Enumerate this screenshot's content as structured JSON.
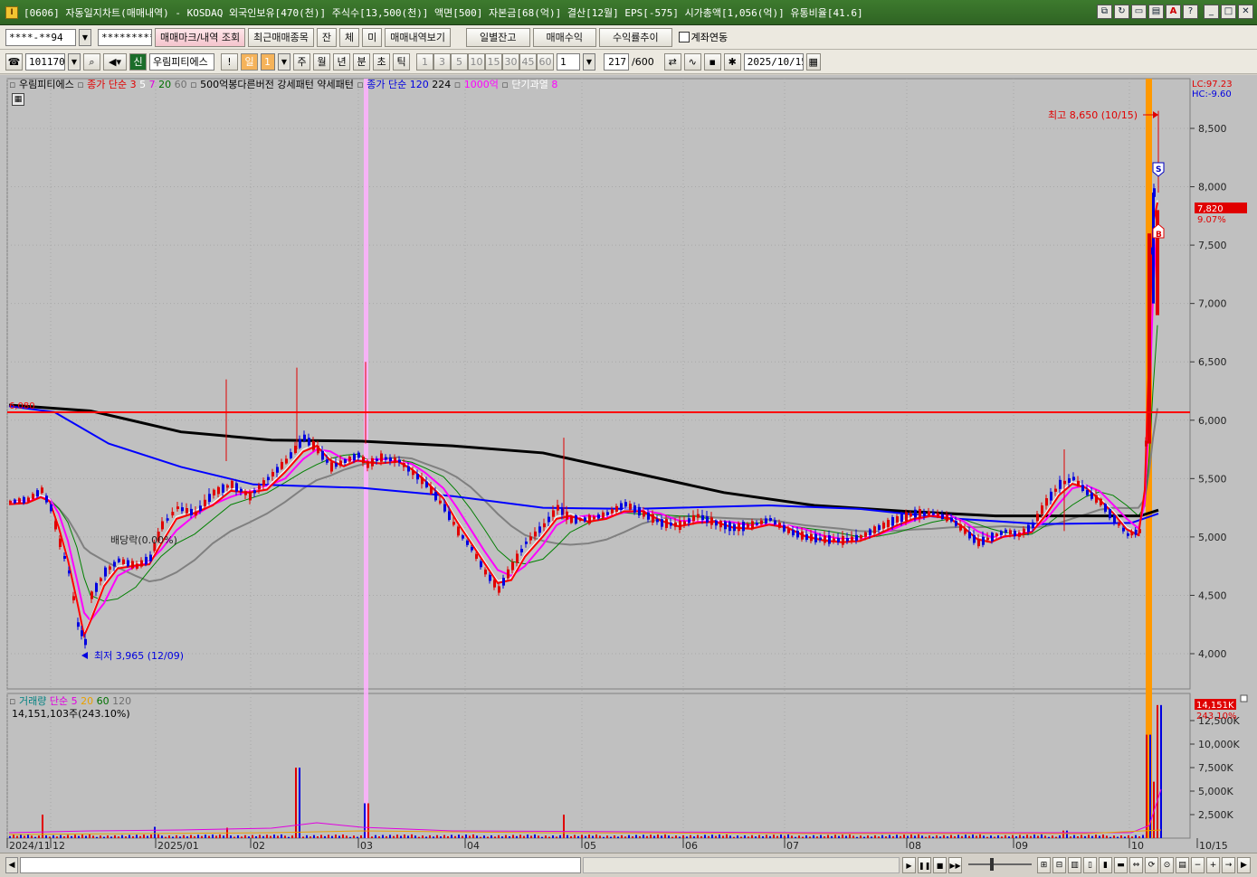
{
  "window": {
    "title": "[0606] 자동일지차트(매매내역) - KOSDAQ 외국인보유[470(천)] 주식수[13,500(천)] 액면[500] 자본금[68(억)] 결산[12월] EPS[-575] 시가총액[1,056(억)] 유통비율[41.6]",
    "icon_name": "app-icon"
  },
  "toolbar1": {
    "account_value": "****-**94",
    "password_value": "*********",
    "btn_mark": "매매마크/내역 조회",
    "btn_recent": "최근매매종목",
    "btn_jan": "잔",
    "btn_che": "체",
    "btn_mi": "미",
    "btn_history": "매매내역보기",
    "btn_daily": "일별잔고",
    "btn_profit": "매매수익",
    "btn_rate": "수익률추이",
    "chk_account_link": "계좌연동"
  },
  "toolbar2": {
    "code_value": "101170",
    "stock_new_badge": "신",
    "stock_name": "우림피티에스",
    "period_day": "일",
    "period_count": "1",
    "period_week": "주",
    "period_month": "월",
    "period_year": "년",
    "period_minute": "분",
    "period_second": "초",
    "period_tick": "틱",
    "intervals": [
      "1",
      "3",
      "5",
      "10",
      "15",
      "30",
      "45",
      "60"
    ],
    "interval_select": "1",
    "count_value": "217",
    "count_total": "/600",
    "date_value": "2025/10/15"
  },
  "price_legend": {
    "name": "우림피티에스",
    "ma_label": "종가 단순",
    "ma_periods": [
      "3",
      "5",
      "7",
      "20",
      "60"
    ],
    "pattern_label": "500억봉다른버전 강세패턴",
    "weak_label": "약세패턴",
    "ma2_label": "종가 단순",
    "ma2_periods": [
      "120",
      "224"
    ],
    "amount_label": "1000억",
    "short_label": "단기과열",
    "short_value": "8"
  },
  "price_axis": {
    "lc": "LC:97.23",
    "hc": "HC:-9.60",
    "ticks": [
      "8,500",
      "8,000",
      "7,500",
      "7,000",
      "6,500",
      "6,000",
      "5,500",
      "5,000",
      "4,500",
      "4,000"
    ],
    "current_price": "7,820",
    "current_change": "9.07%",
    "ref_line_label": "6,080"
  },
  "annotations": {
    "high": "최고 8,650 (10/15)",
    "low": "최저 3,965 (12/09)",
    "dividend": "배당락(0.00%)",
    "marker_s": "S",
    "marker_b": "B"
  },
  "volume_legend": {
    "label": "거래량",
    "ma_label": "단순",
    "periods": [
      "5",
      "20",
      "60",
      "120"
    ],
    "value": "14,151,103주(243.10%)"
  },
  "volume_axis": {
    "current": "14,151K",
    "current_pct": "243.10%",
    "ticks": [
      "12,500K",
      "10,000K",
      "7,500K",
      "5,000K",
      "2,500K"
    ]
  },
  "x_axis": {
    "labels": [
      "2024/11",
      "12",
      "2025/01",
      "02",
      "03",
      "04",
      "05",
      "06",
      "07",
      "08",
      "09",
      "10",
      "10/15"
    ]
  },
  "colors": {
    "up": "#e00000",
    "down": "#0000e0",
    "ma3": "#ff0000",
    "ma5": "#ffffff",
    "ma7": "#ff00ff",
    "ma20": "#008000",
    "ma60": "#808080",
    "ma120": "#0000ff",
    "ma224": "#000000",
    "ref_line": "#ff0000",
    "highlight_pink": "#ffb0ff",
    "highlight_orange": "#ff9900"
  }
}
